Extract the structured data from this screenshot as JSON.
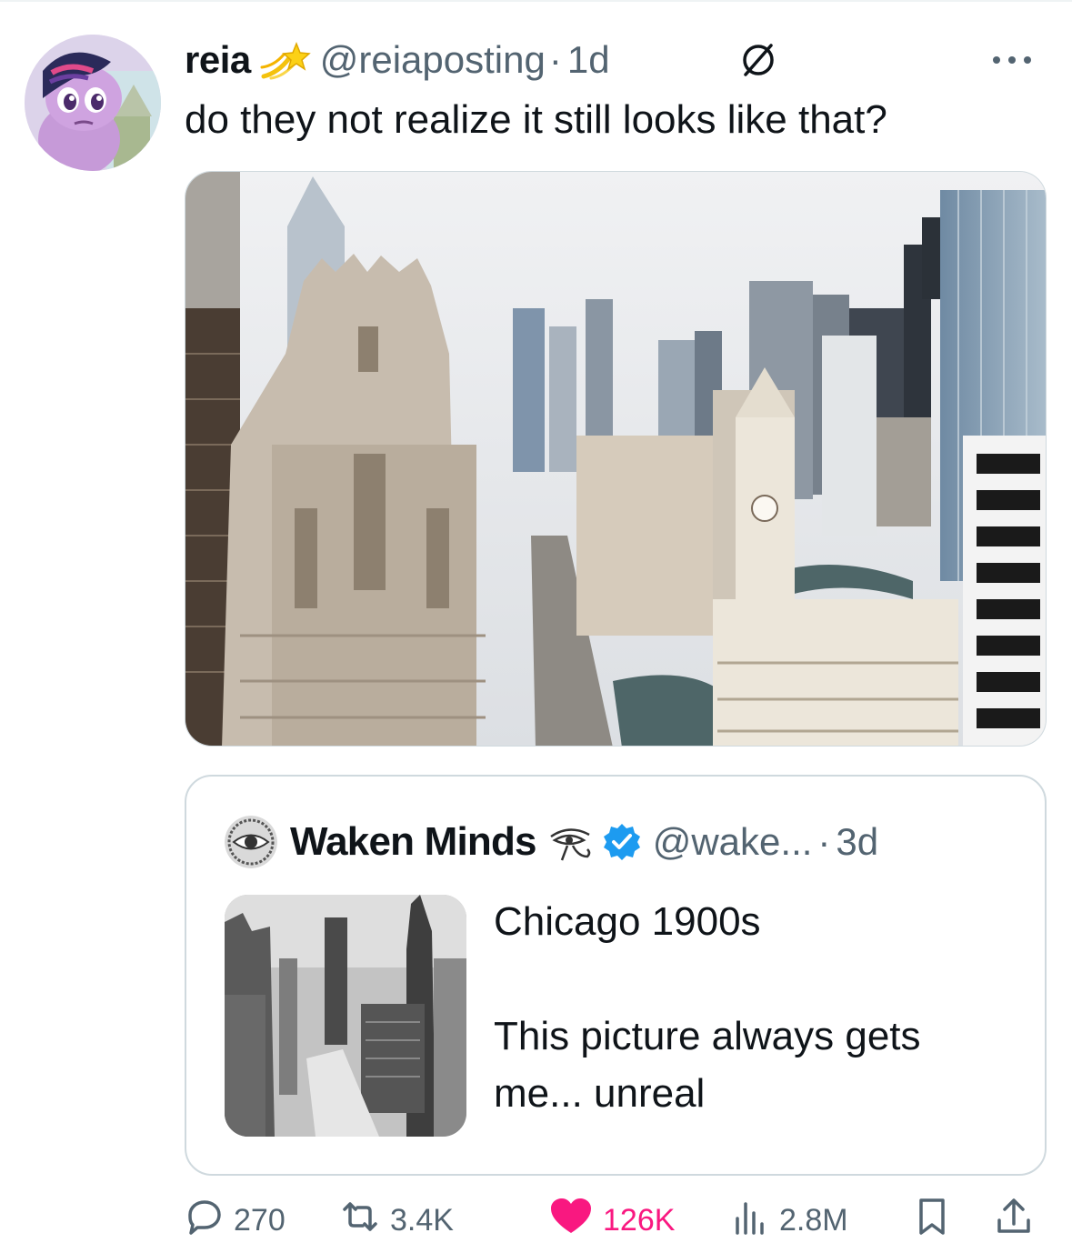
{
  "post": {
    "author": {
      "display_name": "reia",
      "badge_icon": "shooting-star-emoji",
      "handle": "@reiaposting",
      "separator": "·",
      "time": "1d"
    },
    "text": "do they not realize it still looks like that?",
    "media": {
      "subject": "aerial-city-photo"
    }
  },
  "quote": {
    "author": {
      "display_name": "Waken Minds",
      "emoji_icon": "eye-of-horus-icon",
      "verified_icon": "verified-badge-icon",
      "handle": "@wake...",
      "separator": "·",
      "time": "3d"
    },
    "text_lines": [
      "Chicago 1900s",
      "",
      "This picture always gets",
      "me... unreal"
    ]
  },
  "actions": {
    "reply": {
      "icon": "reply-icon",
      "count": "270"
    },
    "retweet": {
      "icon": "retweet-icon",
      "count": "3.4K"
    },
    "like": {
      "icon": "heart-icon",
      "count": "126K",
      "color": "#f91880"
    },
    "views": {
      "icon": "views-icon",
      "count": "2.8M"
    },
    "bookmark": {
      "icon": "bookmark-icon"
    },
    "share": {
      "icon": "share-icon"
    }
  },
  "colors": {
    "text": "#0f1419",
    "secondary": "#536471",
    "border": "#cfd9de",
    "verified": "#1d9bf0",
    "like": "#f91880"
  }
}
